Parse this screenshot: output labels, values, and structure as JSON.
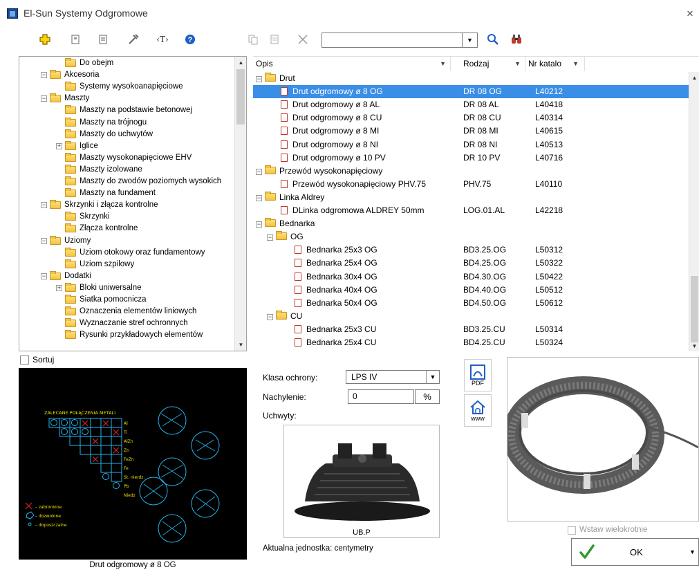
{
  "window": {
    "title": "El-Sun Systemy Odgromowe",
    "close": "×"
  },
  "toolbar": {
    "search_value": "",
    "icons": [
      "add-icon",
      "properties-icon",
      "list-icon",
      "tools-icon",
      "text-tag-icon",
      "help-icon",
      "copy-icon",
      "paste-icon",
      "delete-icon",
      "search-icon",
      "binoculars-icon"
    ],
    "text_tag": "‹T›"
  },
  "tree": {
    "items": [
      {
        "label": "Do obejm",
        "level": 2,
        "expander": ""
      },
      {
        "label": "Akcesoria",
        "level": 1,
        "expander": "−"
      },
      {
        "label": "Systemy wysokoanapięciowe",
        "level": 2,
        "expander": ""
      },
      {
        "label": "Maszty",
        "level": 1,
        "expander": "−"
      },
      {
        "label": "Maszty na podstawie betonowej",
        "level": 2,
        "expander": ""
      },
      {
        "label": "Maszty na trójnogu",
        "level": 2,
        "expander": ""
      },
      {
        "label": "Maszty do uchwytów",
        "level": 2,
        "expander": ""
      },
      {
        "label": "Iglice",
        "level": 2,
        "expander": "+"
      },
      {
        "label": "Maszty wysokonapięciowe EHV",
        "level": 2,
        "expander": ""
      },
      {
        "label": "Maszty izolowane",
        "level": 2,
        "expander": ""
      },
      {
        "label": "Maszty do zwodów poziomych wysokich",
        "level": 2,
        "expander": ""
      },
      {
        "label": "Maszty na fundament",
        "level": 2,
        "expander": ""
      },
      {
        "label": "Skrzynki i złącza kontrolne",
        "level": 1,
        "expander": "−"
      },
      {
        "label": "Skrzynki",
        "level": 2,
        "expander": ""
      },
      {
        "label": "Złącza kontrolne",
        "level": 2,
        "expander": ""
      },
      {
        "label": "Uziomy",
        "level": 1,
        "expander": "−"
      },
      {
        "label": "Uziom otokowy oraz fundamentowy",
        "level": 2,
        "expander": ""
      },
      {
        "label": "Uziom szpilowy",
        "level": 2,
        "expander": ""
      },
      {
        "label": "Dodatki",
        "level": 1,
        "expander": "−"
      },
      {
        "label": "Bloki uniwersalne",
        "level": 2,
        "expander": "+"
      },
      {
        "label": "Siatka pomocnicza",
        "level": 2,
        "expander": ""
      },
      {
        "label": "Oznaczenia elementów liniowych",
        "level": 2,
        "expander": ""
      },
      {
        "label": "Wyznaczanie stref ochronnych",
        "level": 2,
        "expander": ""
      },
      {
        "label": "Rysunki przykładowych elementów",
        "level": 2,
        "expander": ""
      }
    ]
  },
  "list": {
    "columns": [
      "Opis",
      "Rodzaj",
      "Nr katalo"
    ],
    "rows": [
      {
        "type": "group",
        "level": 0,
        "opis": "Drut",
        "rodzaj": "",
        "nr": ""
      },
      {
        "type": "item",
        "level": 1,
        "opis": "Drut odgromowy ø 8 OG",
        "rodzaj": "DR 08 OG",
        "nr": "L40212",
        "selected": true
      },
      {
        "type": "item",
        "level": 1,
        "opis": "Drut odgromowy ø 8 AL",
        "rodzaj": "DR 08 AL",
        "nr": "L40418"
      },
      {
        "type": "item",
        "level": 1,
        "opis": "Drut odgromowy ø 8 CU",
        "rodzaj": "DR 08 CU",
        "nr": "L40314"
      },
      {
        "type": "item",
        "level": 1,
        "opis": "Drut odgromowy ø 8 MI",
        "rodzaj": "DR 08 MI",
        "nr": "L40615"
      },
      {
        "type": "item",
        "level": 1,
        "opis": "Drut odgromowy ø 8 NI",
        "rodzaj": "DR 08 NI",
        "nr": "L40513"
      },
      {
        "type": "item",
        "level": 1,
        "opis": "Drut odgromowy ø 10 PV",
        "rodzaj": "DR 10 PV",
        "nr": "L40716"
      },
      {
        "type": "group",
        "level": 0,
        "opis": "Przewód wysokonapięciowy",
        "rodzaj": "",
        "nr": ""
      },
      {
        "type": "item",
        "level": 1,
        "opis": "Przewód wysokonapięciowy PHV.75",
        "rodzaj": "PHV.75",
        "nr": "L40110"
      },
      {
        "type": "group",
        "level": 0,
        "opis": "Linka Aldrey",
        "rodzaj": "",
        "nr": ""
      },
      {
        "type": "item",
        "level": 1,
        "opis": "DLinka odgromowa ALDREY 50mm",
        "rodzaj": "LOG.01.AL",
        "nr": "L42218"
      },
      {
        "type": "group",
        "level": 0,
        "opis": "Bednarka",
        "rodzaj": "",
        "nr": ""
      },
      {
        "type": "group",
        "level": 1,
        "opis": "OG",
        "rodzaj": "",
        "nr": ""
      },
      {
        "type": "item",
        "level": 2,
        "opis": "Bednarka 25x3 OG",
        "rodzaj": "BD3.25.OG",
        "nr": "L50312"
      },
      {
        "type": "item",
        "level": 2,
        "opis": "Bednarka 25x4 OG",
        "rodzaj": "BD4.25.OG",
        "nr": "L50322"
      },
      {
        "type": "item",
        "level": 2,
        "opis": "Bednarka 30x4 OG",
        "rodzaj": "BD4.30.OG",
        "nr": "L50422"
      },
      {
        "type": "item",
        "level": 2,
        "opis": "Bednarka 40x4 OG",
        "rodzaj": "BD4.40.OG",
        "nr": "L50512"
      },
      {
        "type": "item",
        "level": 2,
        "opis": "Bednarka 50x4 OG",
        "rodzaj": "BD4.50.OG",
        "nr": "L50612"
      },
      {
        "type": "group",
        "level": 1,
        "opis": "CU",
        "rodzaj": "",
        "nr": ""
      },
      {
        "type": "item",
        "level": 2,
        "opis": "Bednarka 25x3 CU",
        "rodzaj": "BD3.25.CU",
        "nr": "L50314"
      },
      {
        "type": "item",
        "level": 2,
        "opis": "Bednarka 25x4 CU",
        "rodzaj": "BD4.25.CU",
        "nr": "L50324"
      }
    ]
  },
  "sort": {
    "label": "Sortuj",
    "checked": false
  },
  "cad": {
    "caption": "Drut odgromowy ø 8 OG",
    "heading": "ZALECANE POŁĄCZENIA METALI",
    "metals": [
      "Al",
      "Ti",
      "AlZn",
      "Zn",
      "FeZn",
      "Fe",
      "St. nierdz.",
      "Pb",
      "Niedz"
    ],
    "legend": [
      "– zabronione",
      "– dozwolone",
      "– dopuszczalne"
    ]
  },
  "form": {
    "klasa_label": "Klasa ochrony:",
    "klasa_value": "LPS IV",
    "nachylenie_label": "Nachylenie:",
    "nachylenie_value": "0",
    "pct_label": "%",
    "uchwyty_label": "Uchwyty:",
    "holder_caption": "UB.P",
    "unit_label": "Aktualna jednostka: centymetry"
  },
  "side_buttons": {
    "pdf_label": "PDF",
    "www_label": "www"
  },
  "actions": {
    "wstaw_label": "Wstaw wielokrotnie",
    "ok_label": "OK"
  },
  "colors": {
    "selection": "#3a8ee6",
    "folder": "#f2c440",
    "cad_cyan": "#23b5f0",
    "cad_yellow": "#f2e400",
    "cad_red": "#e02020"
  }
}
